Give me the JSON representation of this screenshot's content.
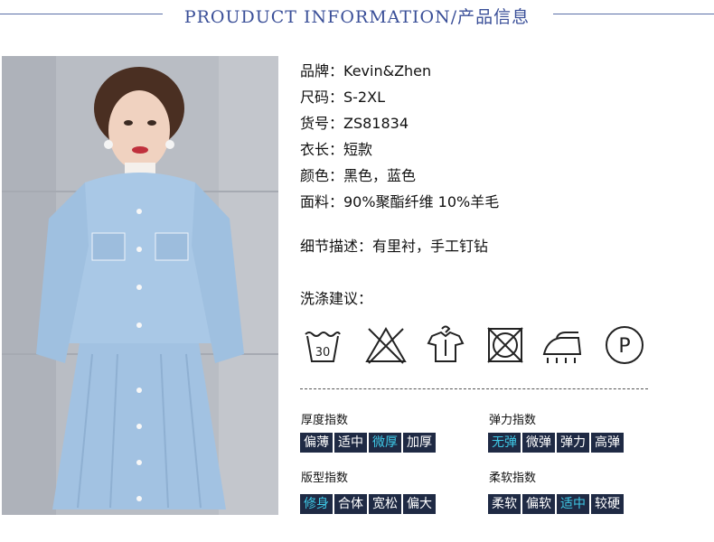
{
  "header": {
    "title": "PROUDUCT INFORMATION/产品信息"
  },
  "specs": [
    {
      "text": "品牌：Kevin&Zhen"
    },
    {
      "text": "尺码：S-2XL"
    },
    {
      "text": "货号：ZS81834"
    },
    {
      "text": "衣长：短款"
    },
    {
      "text": "颜色：黑色，蓝色"
    },
    {
      "text": "面料：90%聚酯纤维 10%羊毛"
    }
  ],
  "detail": {
    "text": "细节描述：有里衬，手工钉钻"
  },
  "care": {
    "title": "洗涤建议：",
    "wash_temp": "30",
    "iron_label": "P",
    "icons": [
      "wash-30-icon",
      "no-bleach-icon",
      "hang-dry-icon",
      "no-tumble-dry-icon",
      "iron-icon",
      "dry-clean-p-icon"
    ]
  },
  "indices": {
    "thickness": {
      "title": "厚度指数",
      "options": [
        "偏薄",
        "适中",
        "微厚",
        "加厚"
      ],
      "selected": "微厚"
    },
    "elasticity": {
      "title": "弹力指数",
      "options": [
        "无弹",
        "微弹",
        "弹力",
        "高弹"
      ],
      "selected": "无弹"
    },
    "fit": {
      "title": "版型指数",
      "options": [
        "修身",
        "合体",
        "宽松",
        "偏大"
      ],
      "selected": "修身"
    },
    "softness": {
      "title": "柔软指数",
      "options": [
        "柔软",
        "偏软",
        "适中",
        "较硬"
      ],
      "selected": "适中"
    }
  },
  "colors": {
    "header": "#3a4f98",
    "segment_bg": "#1f2a44",
    "segment_active_text": "#3ec8e6",
    "jacket": "#a9c8e6"
  }
}
